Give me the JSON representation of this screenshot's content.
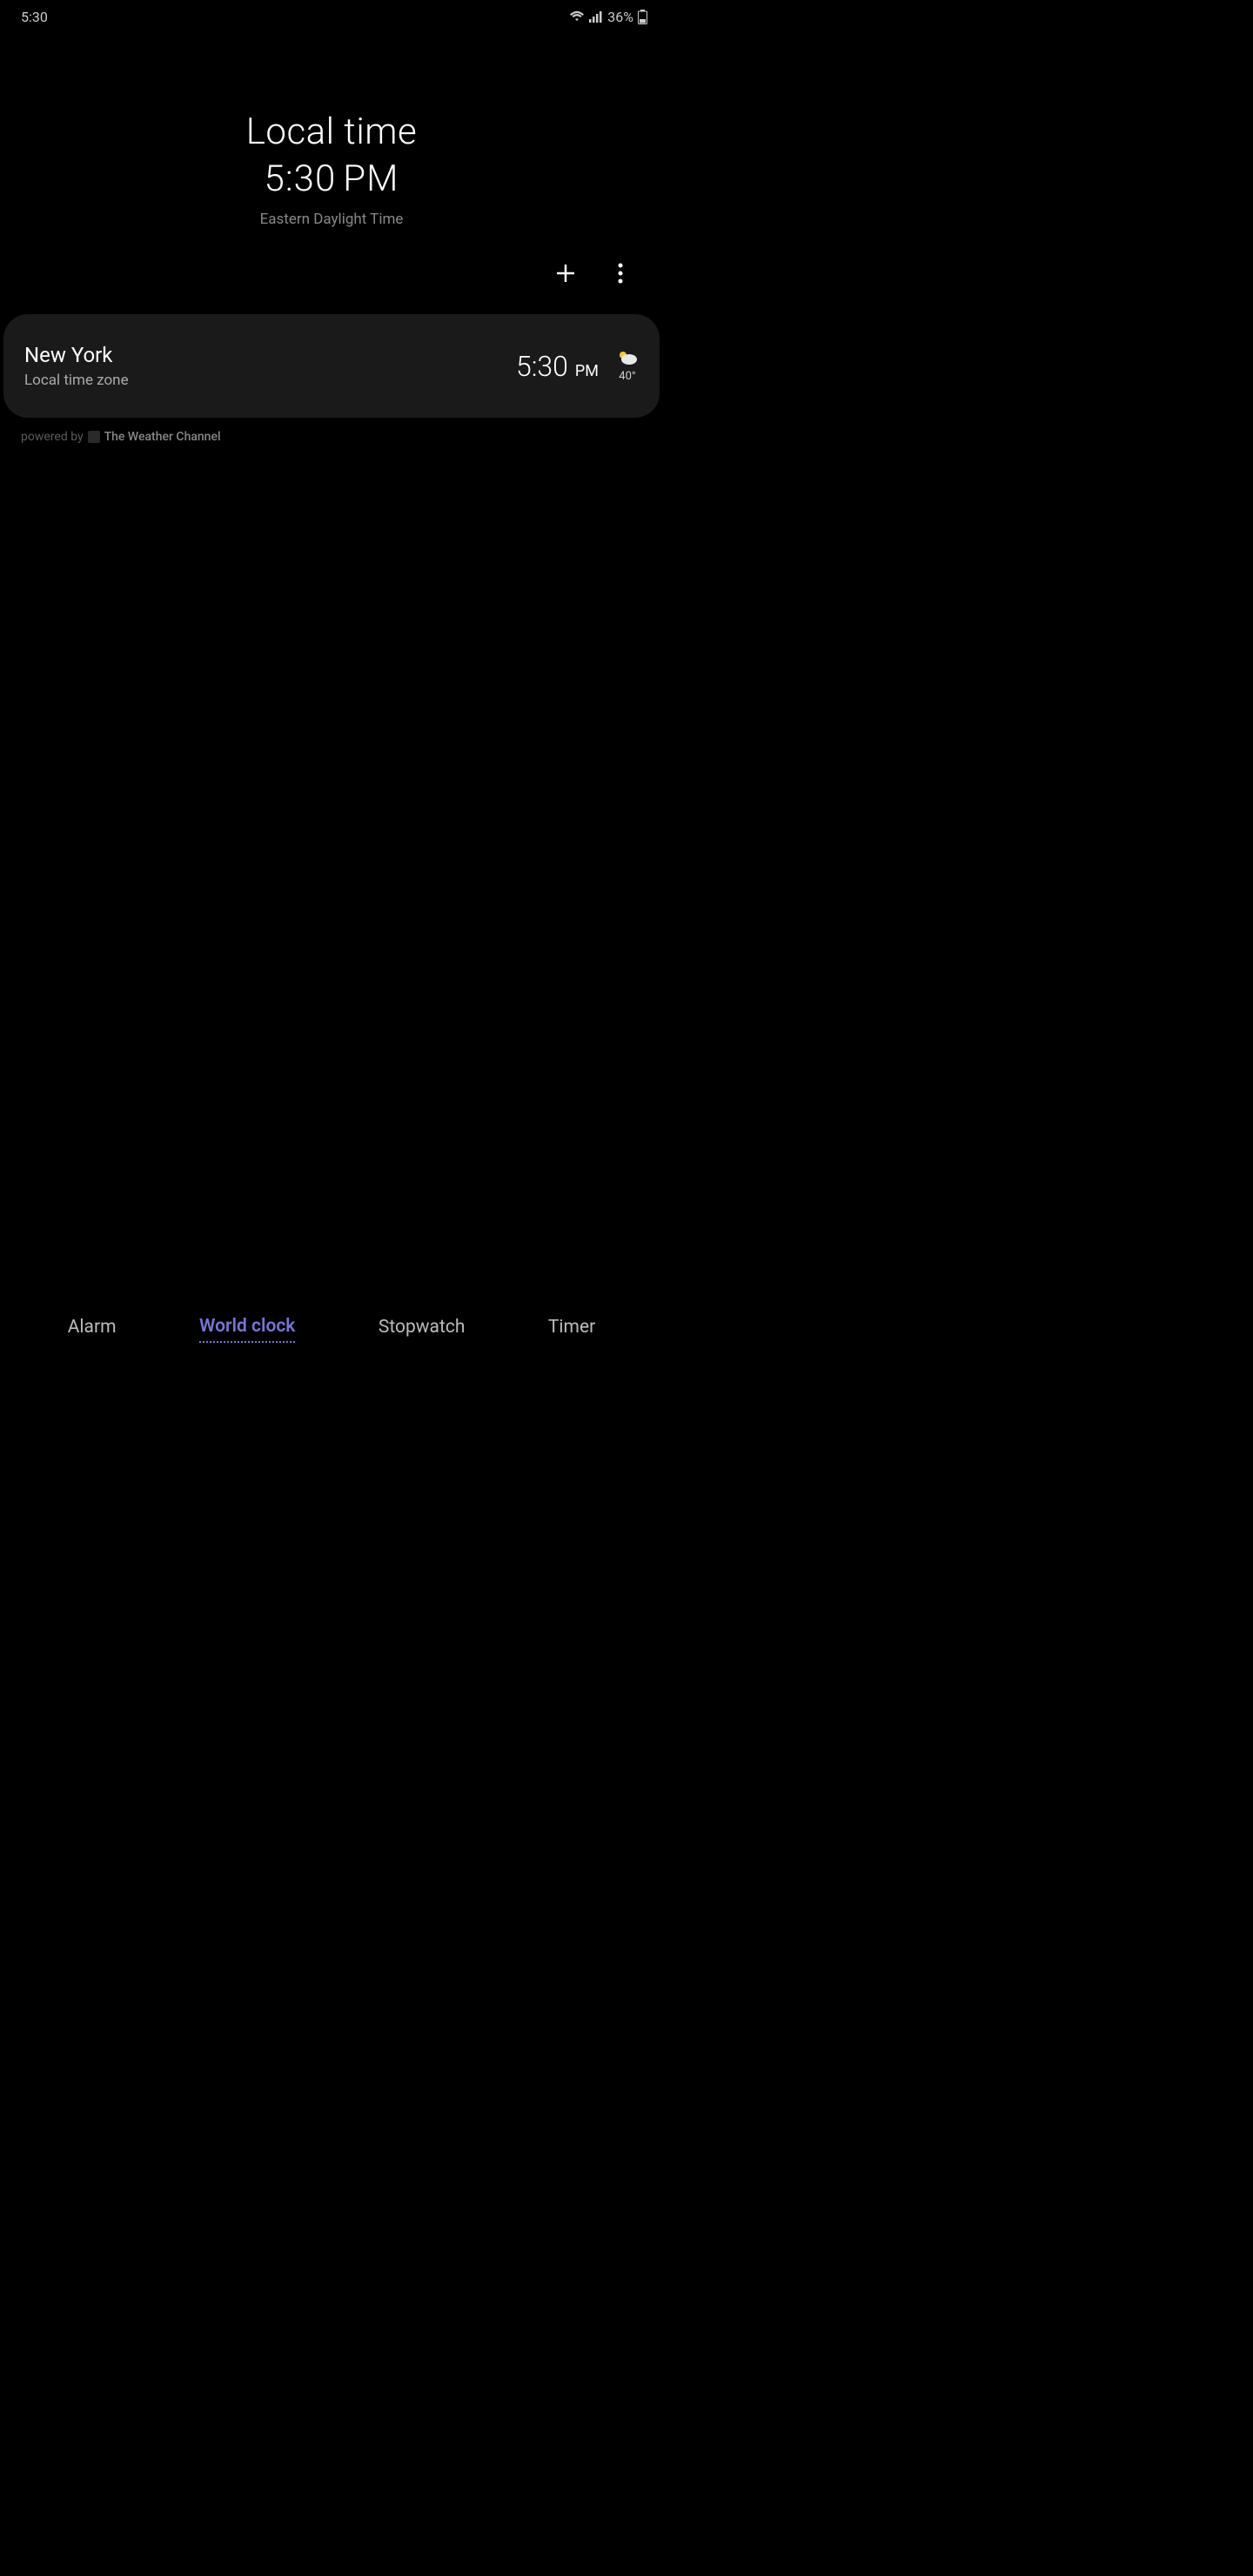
{
  "status_bar": {
    "time": "5:30",
    "battery_percent": "36%"
  },
  "header": {
    "title": "Local time",
    "time": "5:30",
    "ampm": "PM",
    "timezone": "Eastern Daylight Time"
  },
  "cities": [
    {
      "name": "New York",
      "subtitle": "Local time zone",
      "time": "5:30",
      "ampm": "PM",
      "temp": "40°"
    }
  ],
  "attribution": {
    "prefix": "powered by",
    "brand": "The Weather Channel"
  },
  "tabs": {
    "alarm": "Alarm",
    "world_clock": "World clock",
    "stopwatch": "Stopwatch",
    "timer": "Timer"
  }
}
